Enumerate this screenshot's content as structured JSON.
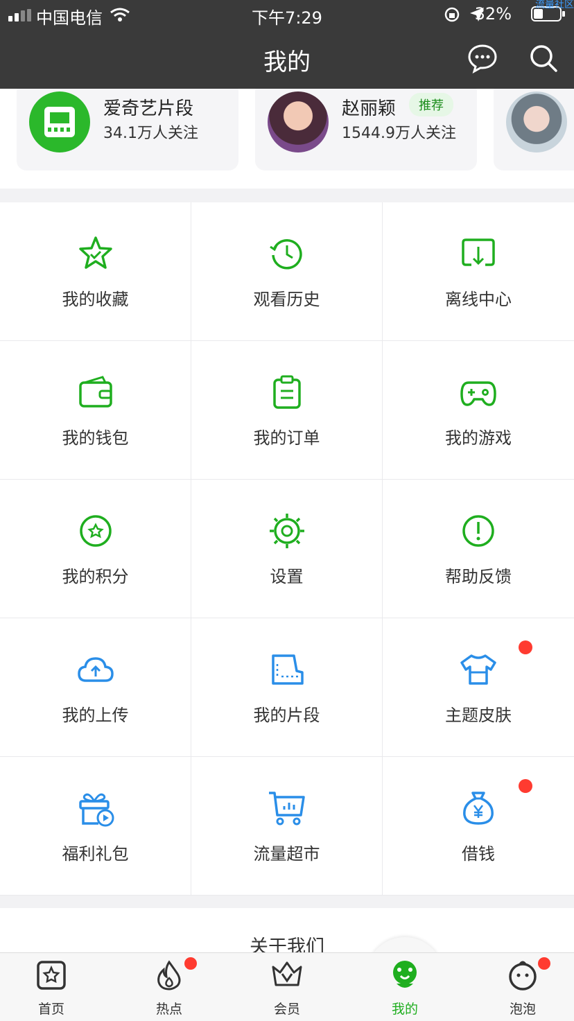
{
  "status_bar": {
    "carrier": "中国电信",
    "time": "下午7:29",
    "battery": "32%",
    "corner_text": "流量社区"
  },
  "header": {
    "title": "我的"
  },
  "creators": [
    {
      "name": "爱奇艺片段",
      "followers": "34.1万人关注",
      "tag": ""
    },
    {
      "name": "赵丽颖",
      "followers": "1544.9万人关注",
      "tag": "推荐"
    },
    {
      "name": "",
      "followers": "",
      "tag": ""
    }
  ],
  "grid": {
    "items": [
      {
        "label": "我的收藏",
        "icon": "star-icon",
        "badge": false
      },
      {
        "label": "观看历史",
        "icon": "history-icon",
        "badge": false
      },
      {
        "label": "离线中心",
        "icon": "download-icon",
        "badge": false
      },
      {
        "label": "我的钱包",
        "icon": "wallet-icon",
        "badge": false
      },
      {
        "label": "我的订单",
        "icon": "order-icon",
        "badge": false
      },
      {
        "label": "我的游戏",
        "icon": "gamepad-icon",
        "badge": false
      },
      {
        "label": "我的积分",
        "icon": "points-icon",
        "badge": false
      },
      {
        "label": "设置",
        "icon": "settings-icon",
        "badge": false
      },
      {
        "label": "帮助反馈",
        "icon": "help-icon",
        "badge": false
      },
      {
        "label": "我的上传",
        "icon": "upload-cloud-icon",
        "badge": false
      },
      {
        "label": "我的片段",
        "icon": "clip-icon",
        "badge": false
      },
      {
        "label": "主题皮肤",
        "icon": "shirt-icon",
        "badge": true
      },
      {
        "label": "福利礼包",
        "icon": "gift-icon",
        "badge": false
      },
      {
        "label": "流量超市",
        "icon": "cart-icon",
        "badge": false
      },
      {
        "label": "借钱",
        "icon": "money-bag-icon",
        "badge": true
      }
    ]
  },
  "about": {
    "label": "关于我们"
  },
  "tabbar": {
    "items": [
      {
        "label": "首页",
        "icon": "home-icon",
        "badge": false,
        "active": false
      },
      {
        "label": "热点",
        "icon": "fire-icon",
        "badge": true,
        "active": false
      },
      {
        "label": "会员",
        "icon": "crown-icon",
        "badge": false,
        "active": false
      },
      {
        "label": "我的",
        "icon": "mine-icon",
        "badge": false,
        "active": true
      },
      {
        "label": "泡泡",
        "icon": "bubble-icon",
        "badge": true,
        "active": false
      }
    ]
  },
  "colors": {
    "green": "#1fae1f",
    "blue": "#2a8ee8",
    "badge_red": "#ff3b30",
    "header_bg": "#3a3a3a"
  }
}
